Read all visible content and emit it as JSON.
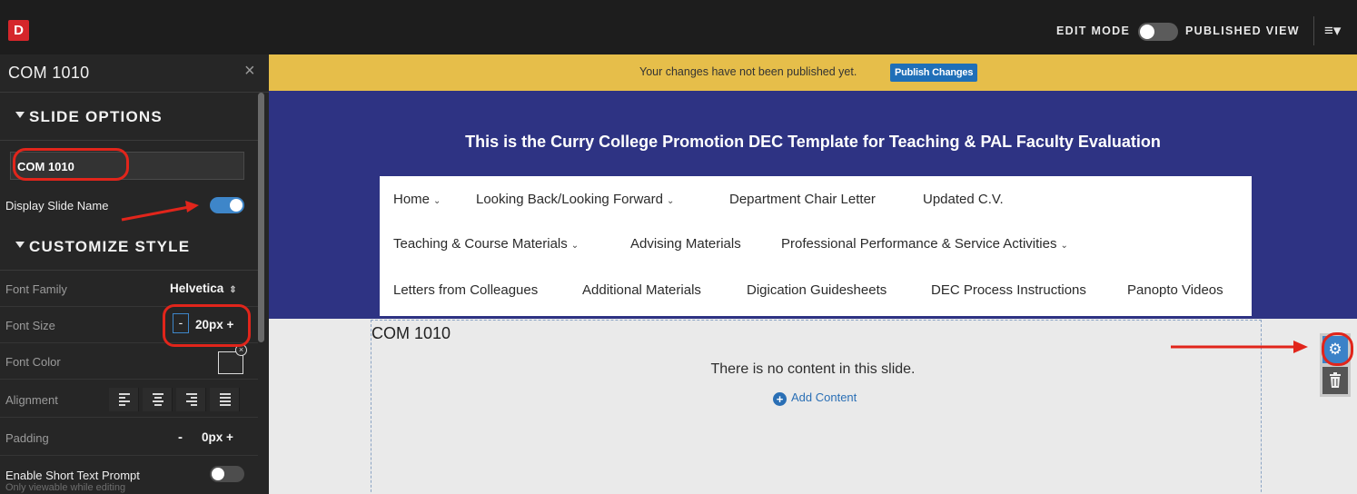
{
  "topbar": {
    "logo": "D",
    "edit_mode": "EDIT MODE",
    "published_view": "PUBLISHED VIEW",
    "menu_icon": "≡▾"
  },
  "panel": {
    "title": "COM 1010",
    "close": "×",
    "slide_options": {
      "heading": "SLIDE OPTIONS",
      "slide_name_value": "COM 1010",
      "display_slide_name": {
        "label": "Display Slide Name",
        "enabled": true
      }
    },
    "customize_style": {
      "heading": "CUSTOMIZE STYLE",
      "font_family": {
        "label": "Font Family",
        "value": "Helvetica"
      },
      "font_size": {
        "label": "Font Size",
        "minus": "-",
        "value": "20px +"
      },
      "font_color": {
        "label": "Font Color",
        "color": "#2a2a2a"
      },
      "alignment": {
        "label": "Alignment",
        "options": [
          "left-align-icon",
          "center-align-icon",
          "right-align-icon",
          "justify-align-icon"
        ]
      },
      "padding": {
        "label": "Padding",
        "minus": "-",
        "value": "0px +"
      },
      "short_text_prompt": {
        "label": "Enable Short Text Prompt",
        "hint": "Only viewable while editing",
        "enabled": false
      }
    }
  },
  "banner": {
    "text": "Your changes have not been published yet.",
    "button": "Publish Changes"
  },
  "site": {
    "title": "This is the Curry College Promotion DEC Template for Teaching & PAL Faculty Evaluation",
    "nav": [
      {
        "label": "Home",
        "dropdown": true
      },
      {
        "label": "Looking Back/Looking Forward",
        "dropdown": true
      },
      {
        "label": "Department Chair Letter",
        "dropdown": false
      },
      {
        "label": "Updated C.V.",
        "dropdown": false
      },
      {
        "label": "Teaching & Course Materials",
        "dropdown": true
      },
      {
        "label": "Advising Materials",
        "dropdown": false
      },
      {
        "label": "Professional Performance & Service Activities",
        "dropdown": true
      },
      {
        "label": "Letters from Colleagues",
        "dropdown": false
      },
      {
        "label": "Additional Materials",
        "dropdown": false
      },
      {
        "label": "Digication Guidesheets",
        "dropdown": false
      },
      {
        "label": "DEC Process Instructions",
        "dropdown": false
      },
      {
        "label": "Panopto Videos",
        "dropdown": false
      }
    ],
    "dropdown_glyph": "⌄"
  },
  "slide": {
    "name": "COM 1010",
    "empty_message": "There is no content in this slide.",
    "add_content": "Add Content"
  },
  "colors": {
    "accent": "#3e86c9",
    "header_bg": "#2e3383",
    "banner_bg": "#e6be4a",
    "annotation": "#e1251b"
  }
}
